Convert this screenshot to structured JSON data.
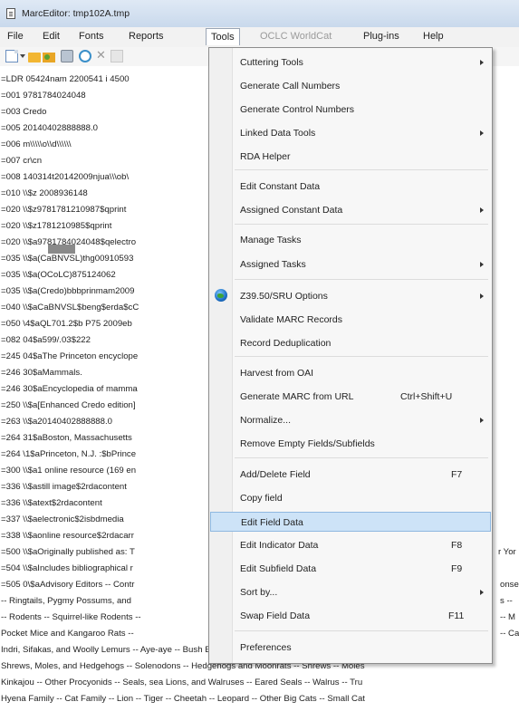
{
  "window": {
    "title": "MarcEditor: tmp102A.tmp"
  },
  "menubar": {
    "items": [
      {
        "label": "File"
      },
      {
        "label": "Edit"
      },
      {
        "label": "Fonts"
      },
      {
        "label": "Reports"
      },
      {
        "label": "Tools"
      },
      {
        "label": "OCLC WorldCat"
      },
      {
        "label": "Plug-ins"
      },
      {
        "label": "Help"
      }
    ],
    "active": "Tools",
    "disabled": "OCLC WorldCat"
  },
  "toolbar": {
    "icons": [
      "new-document-icon",
      "dropdown-arrow-icon",
      "open-folder-icon",
      "open-folder-2-icon",
      "print-icon",
      "web-icon",
      "cut-icon",
      "more-icon"
    ]
  },
  "editor": {
    "lines": [
      "=LDR  05424nam  2200541 i 4500",
      "=001  9781784024048",
      "=003  Credo",
      "=005  20140402888888.0",
      "=006  m\\\\\\\\\\o\\\\d\\\\\\\\\\\\",
      "=007  cr\\cn",
      "=008  140314t20142009njua\\\\\\ob\\",
      "=010  \\\\$z  2008936148",
      "=020  \\\\$z9781781210987$qprint",
      "=020  \\\\$z1781210985$qprint",
      "=020  \\\\$a9781784024048$qelectro",
      "=035  \\\\$a(CaBNVSL)thg00910593",
      "=035  \\\\$a(OCoLC)875124062",
      "=035  \\\\$a(Credo)bbbprinmam2009",
      "=040  \\\\$aCaBNVSL$beng$erda$cC",
      "=050  \\4$aQL701.2$b P75 2009eb",
      "=082  04$a599/.03$222",
      "=245  04$aThe Princeton encyclope",
      "=246  30$aMammals.",
      "=246  30$aEncyclopedia of mamma",
      "=250  \\\\$a[Enhanced Credo edition]",
      "=263  \\\\$a20140402888888.0",
      "=264  31$aBoston, Massachusetts",
      "=264  \\1$aPrinceton, N.J. :$bPrince",
      "=300  \\\\$a1 online resource (169 en",
      "=336  \\\\$astill image$2rdacontent",
      "=336  \\\\$atext$2rdacontent",
      "=337  \\\\$aelectronic$2isbdmedia",
      "=338  \\\\$aonline resource$2rdacarr",
      "=500  \\\\$aOriginally published as: T",
      "=504  \\\\$aIncludes bibliographical r",
      "=505  0\\$aAdvisory Editors -- Contr",
      "-- Ringtails, Pygmy Possums, and",
      "-- Rodents -- Squirrel-like Rodents --",
      "Pocket Mice and Kangaroo Rats --",
      "Indri, Sifakas, and Woolly Lemurs -- Aye-aye -- Bush Babies, Lorises, and Pottos -- Monkeys a",
      "Shrews, Moles, and Hedgehogs -- Solenodons -- Hedgehogs and Moonrats -- Shrews -- Moles",
      "Kinkajou -- Other Procyonids -- Seals, sea Lions, and Walruses -- Eared Seals -- Walrus -- Tru",
      "Hyena Family -- Cat Family -- Lion -- Tiger -- Cheetah -- Leopard -- Other Big Cats -- Small Cat"
    ],
    "right_fragments": [
      {
        "line": 29,
        "text": "r Yor"
      },
      {
        "line": 31,
        "text": "onser"
      },
      {
        "line": 32,
        "text": "s -- "
      },
      {
        "line": 33,
        "text": "-- M"
      },
      {
        "line": 34,
        "text": "-- Ca"
      }
    ]
  },
  "tools_menu": {
    "items": [
      {
        "label": "Cuttering Tools",
        "submenu": true
      },
      {
        "label": "Generate Call Numbers"
      },
      {
        "label": "Generate Control Numbers"
      },
      {
        "label": "Linked Data Tools",
        "submenu": true
      },
      {
        "label": "RDA Helper"
      },
      {
        "separator": true
      },
      {
        "label": "Edit Constant Data"
      },
      {
        "label": "Assigned Constant Data",
        "submenu": true
      },
      {
        "separator": true
      },
      {
        "label": "Manage Tasks"
      },
      {
        "label": "Assigned Tasks",
        "submenu": true
      },
      {
        "separator": true
      },
      {
        "label": "Z39.50/SRU Options",
        "submenu": true,
        "icon": "globe-icon"
      },
      {
        "label": "Validate MARC Records"
      },
      {
        "label": "Record Deduplication"
      },
      {
        "separator": true
      },
      {
        "label": "Harvest from OAI"
      },
      {
        "label": "Generate MARC from URL",
        "shortcut": "Ctrl+Shift+U"
      },
      {
        "label": "Normalize...",
        "submenu": true
      },
      {
        "label": "Remove Empty Fields/Subfields"
      },
      {
        "separator": true
      },
      {
        "label": "Add/Delete Field",
        "shortcut": "F7"
      },
      {
        "label": "Copy field"
      },
      {
        "label": "Edit Field Data",
        "highlighted": true
      },
      {
        "label": "Edit Indicator Data",
        "shortcut": "F8"
      },
      {
        "label": "Edit Subfield Data",
        "shortcut": "F9"
      },
      {
        "label": "Sort by...",
        "submenu": true
      },
      {
        "label": "Swap Field Data",
        "shortcut": "F11"
      },
      {
        "separator": true
      },
      {
        "label": "Preferences"
      }
    ]
  }
}
